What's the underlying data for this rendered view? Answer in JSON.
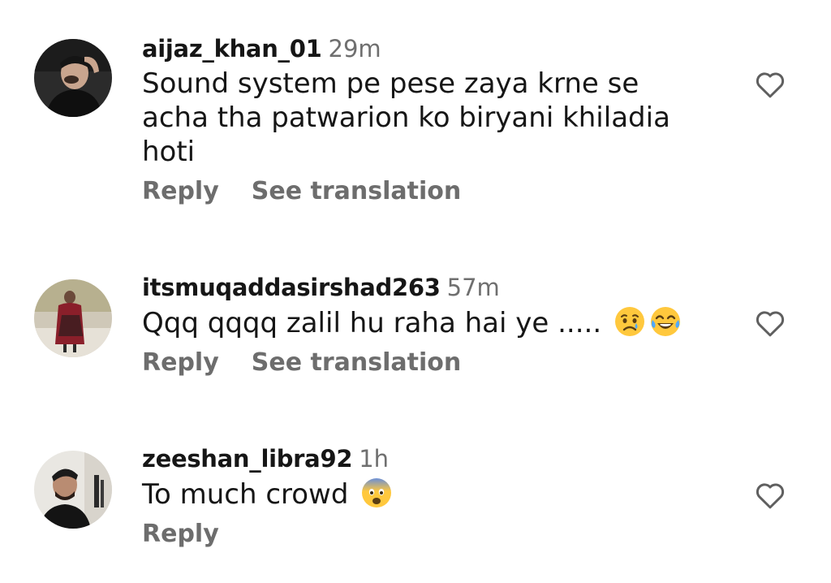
{
  "comments": [
    {
      "username": "aijaz_khan_01",
      "time": "29m",
      "text_lines": [
        "Sound system pe pese zaya krne se",
        "acha tha patwarion ko biryani khiladia",
        "hoti"
      ],
      "reply_label": "Reply",
      "translate_label": "See translation"
    },
    {
      "username": "itsmuqaddasirshad263",
      "time": "57m",
      "text": "Qqq qqqq zalil hu raha hai ye .....",
      "emojis": [
        "crying-face",
        "tears-of-joy-face"
      ],
      "reply_label": "Reply",
      "translate_label": "See translation"
    },
    {
      "username": "zeeshan_libra92",
      "time": "1h",
      "text": "To much crowd",
      "emojis": [
        "fearful-face"
      ],
      "reply_label": "Reply"
    }
  ],
  "icons": {
    "like": "heart-outline-icon"
  },
  "colors": {
    "username": "#161616",
    "muted": "#6d6d6d",
    "emoji_yellow": "#ffc83d"
  }
}
